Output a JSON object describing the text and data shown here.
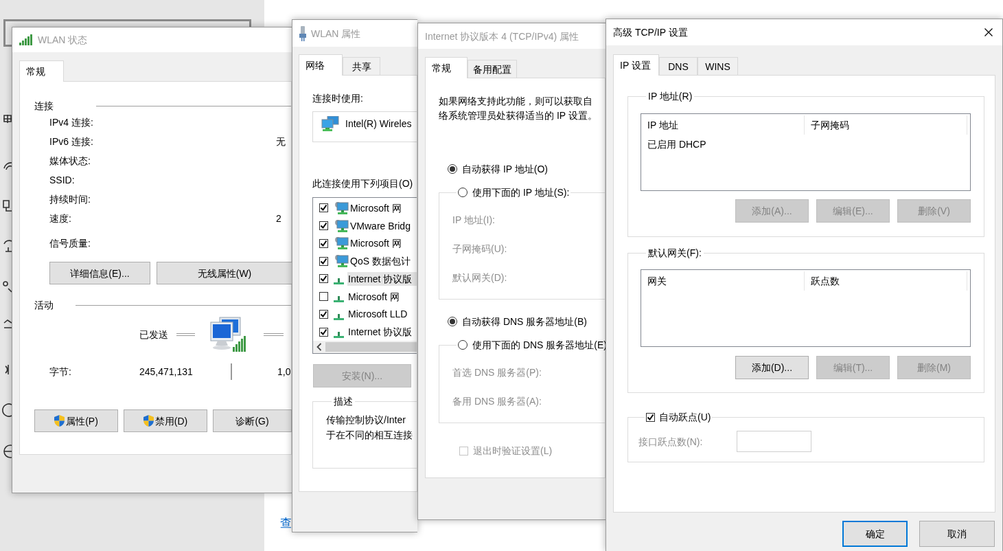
{
  "desktop": {
    "link": "查"
  },
  "wlan_status": {
    "title": "WLAN 状态",
    "active": false,
    "tabs": [
      {
        "label": "常规",
        "selected": true
      }
    ],
    "connection_heading": "连接",
    "connection_rows": [
      {
        "label": "IPv4 连接:"
      },
      {
        "label": "IPv6 连接:",
        "value": "无"
      },
      {
        "label": "媒体状态:"
      },
      {
        "label": "SSID:"
      },
      {
        "label": "持续时间:"
      },
      {
        "label": "速度:",
        "value": "2"
      }
    ],
    "signal_label": "信号质量:",
    "connection_buttons": [
      {
        "label": "详细信息(E)..."
      },
      {
        "label": "无线属性(W)"
      }
    ],
    "activity_heading": "活动",
    "sent_label": "已发送",
    "bytes_label": "字节:",
    "bytes_sent": "245,471,131",
    "bytes_received": "1,0",
    "buttons": [
      {
        "label": "属性(P)",
        "shield": true
      },
      {
        "label": "禁用(D)",
        "shield": true
      },
      {
        "label": "诊断(G)",
        "shield": false
      }
    ]
  },
  "wlan_properties": {
    "title": "WLAN 属性",
    "active": false,
    "tabs": [
      {
        "label": "网络",
        "selected": true
      },
      {
        "label": "共享",
        "selected": false
      }
    ],
    "connect_using_label": "连接时使用:",
    "adapter": "Intel(R) Wireles",
    "items_label": "此连接使用下列项目(O)",
    "items": [
      {
        "label": "Microsoft 网",
        "kind": "client",
        "checked": true,
        "selected": false
      },
      {
        "label": "VMware Bridg",
        "kind": "client",
        "checked": true,
        "selected": false
      },
      {
        "label": "Microsoft 网",
        "kind": "client",
        "checked": true,
        "selected": false
      },
      {
        "label": "QoS 数据包计",
        "kind": "client",
        "checked": true,
        "selected": false
      },
      {
        "label": "Internet 协议版",
        "kind": "protocol",
        "checked": true,
        "selected": true
      },
      {
        "label": "Microsoft 网",
        "kind": "protocol",
        "checked": false,
        "selected": false
      },
      {
        "label": "Microsoft LLD",
        "kind": "protocol",
        "checked": true,
        "selected": false
      },
      {
        "label": "Internet 协议版",
        "kind": "protocol",
        "checked": true,
        "selected": false
      }
    ],
    "install_button": {
      "label": "安装(N)...",
      "disabled": true
    },
    "description_heading": "描述",
    "description_lines": [
      "传输控制协议/Inter",
      "于在不同的相互连接"
    ]
  },
  "ipv4_properties": {
    "title": "Internet 协议版本 4 (TCP/IPv4) 属性",
    "active": false,
    "tabs": [
      {
        "label": "常规",
        "selected": true
      },
      {
        "label": "备用配置",
        "selected": false
      }
    ],
    "intro_lines": [
      "如果网络支持此功能，则可以获取自",
      "络系统管理员处获得适当的 IP 设置。"
    ],
    "ip_options": [
      {
        "label": "自动获得 IP 地址(O)",
        "selected": true
      },
      {
        "label": "使用下面的 IP 地址(S):",
        "selected": false
      }
    ],
    "ip_fields": [
      {
        "label": "IP 地址(I):",
        "disabled": true
      },
      {
        "label": "子网掩码(U):",
        "disabled": true
      },
      {
        "label": "默认网关(D):",
        "disabled": true
      }
    ],
    "dns_options": [
      {
        "label": "自动获得 DNS 服务器地址(B)",
        "selected": true
      },
      {
        "label": "使用下面的 DNS 服务器地址(E)",
        "selected": false
      }
    ],
    "dns_fields": [
      {
        "label": "首选 DNS 服务器(P):",
        "disabled": true
      },
      {
        "label": "备用 DNS 服务器(A):",
        "disabled": true
      }
    ],
    "validate": {
      "label": "退出时验证设置(L)",
      "checked": false,
      "disabled": true
    }
  },
  "advanced_tcpip": {
    "title": "高级 TCP/IP 设置",
    "active": true,
    "tabs": [
      {
        "label": "IP 设置",
        "selected": true
      },
      {
        "label": "DNS",
        "selected": false
      },
      {
        "label": "WINS",
        "selected": false
      }
    ],
    "ip_group": {
      "heading": "IP 地址(R)",
      "columns": [
        "IP 地址",
        "子网掩码"
      ],
      "rows": [
        [
          "已启用 DHCP"
        ]
      ],
      "buttons": [
        {
          "label": "添加(A)...",
          "disabled": true
        },
        {
          "label": "编辑(E)...",
          "disabled": true
        },
        {
          "label": "删除(V)",
          "disabled": true
        }
      ]
    },
    "gateway_group": {
      "heading": "默认网关(F):",
      "columns": [
        "网关",
        "跃点数"
      ],
      "buttons": [
        {
          "label": "添加(D)...",
          "disabled": false
        },
        {
          "label": "编辑(T)...",
          "disabled": true
        },
        {
          "label": "删除(M)",
          "disabled": true
        }
      ]
    },
    "auto_metric": {
      "label": "自动跃点(U)",
      "checked": true
    },
    "metric_field": {
      "label": "接口跃点数(N):",
      "disabled": true
    },
    "footer_buttons": [
      {
        "label": "确定",
        "default": true
      },
      {
        "label": "取消",
        "default": false
      }
    ]
  }
}
